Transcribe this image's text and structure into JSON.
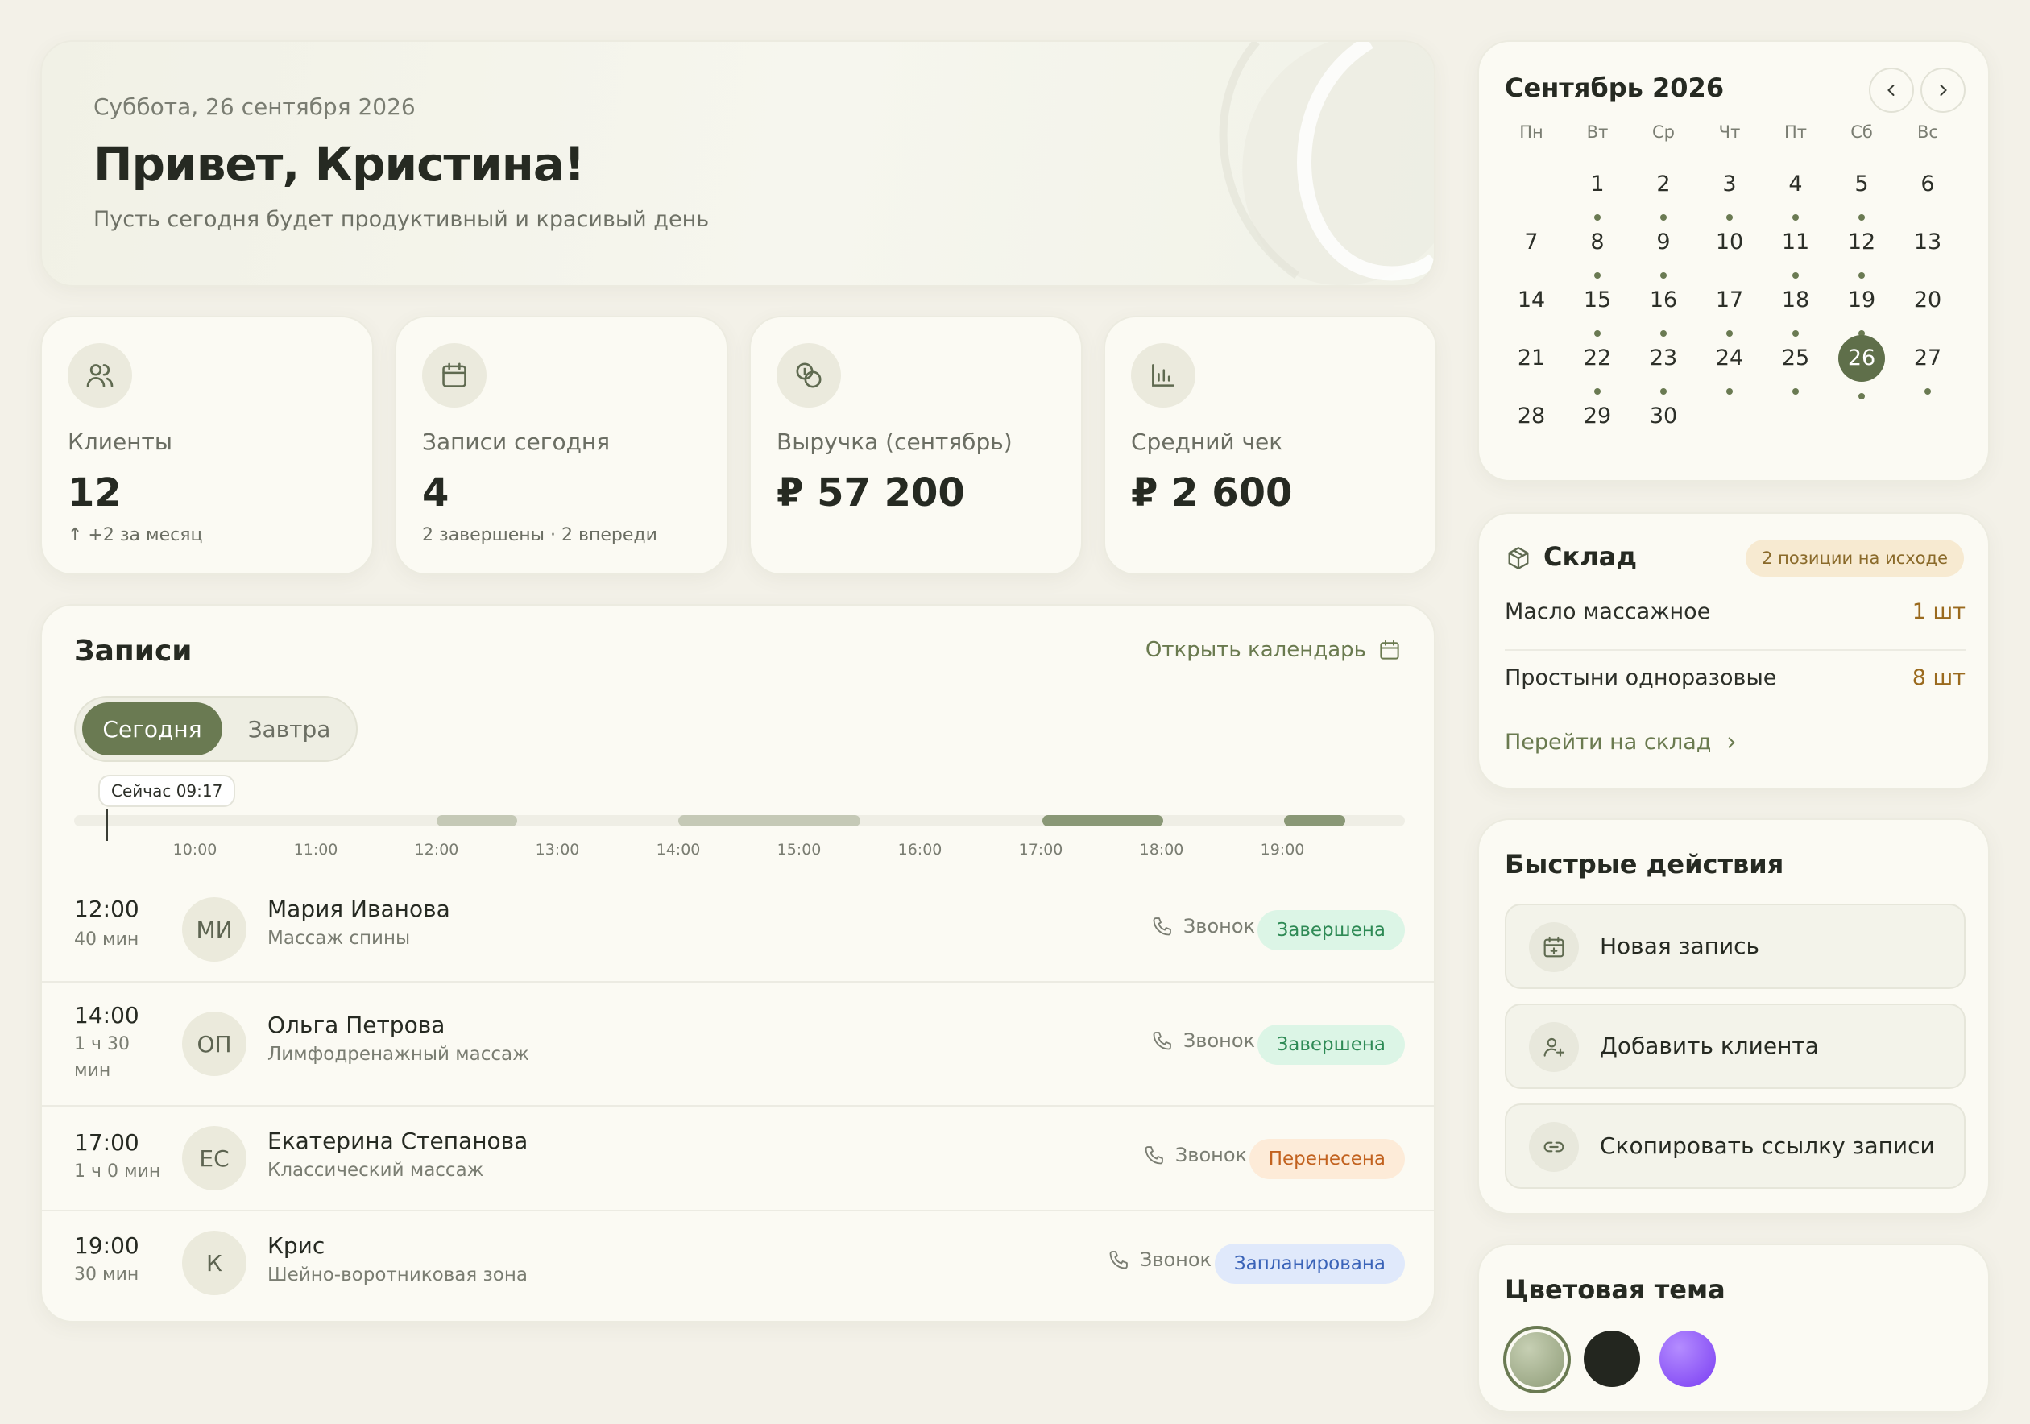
{
  "hero": {
    "date": "Суббота, 26 сентября 2026",
    "greeting": "Привет, Кристина!",
    "subtitle": "Пусть сегодня будет продуктивный и красивый день"
  },
  "stats": [
    {
      "label": "Клиенты",
      "value": "12",
      "note": "↑ +2 за месяц",
      "icon": "users-icon"
    },
    {
      "label": "Записи сегодня",
      "value": "4",
      "note": "2 завершены · 2 впереди",
      "icon": "calendar-icon"
    },
    {
      "label": "Выручка (сентябрь)",
      "value": "₽ 57 200",
      "note": "",
      "icon": "coins-icon"
    },
    {
      "label": "Средний чек",
      "value": "₽ 2 600",
      "note": "",
      "icon": "bar-chart-icon"
    }
  ],
  "appointments": {
    "title": "Записи",
    "open_calendar": "Открыть календарь",
    "tabs": {
      "today": "Сегодня",
      "tomorrow": "Завтра"
    },
    "now_label": "Сейчас 09:17",
    "ticks": [
      "10:00",
      "11:00",
      "12:00",
      "13:00",
      "14:00",
      "15:00",
      "16:00",
      "17:00",
      "18:00",
      "19:00"
    ],
    "rows": [
      {
        "time": "12:00",
        "duration": "40 мин",
        "initials": "МИ",
        "name": "Мария Иванова",
        "service": "Массаж спины",
        "call": "Звонок",
        "status": "Завершена"
      },
      {
        "time": "14:00",
        "duration": "1 ч 30 мин",
        "initials": "ОП",
        "name": "Ольга Петрова",
        "service": "Лимфодренажный массаж",
        "call": "Звонок",
        "status": "Завершена"
      },
      {
        "time": "17:00",
        "duration": "1 ч 0 мин",
        "initials": "ЕС",
        "name": "Екатерина Степанова",
        "service": "Классический массаж",
        "call": "Звонок",
        "status": "Перенесена"
      },
      {
        "time": "19:00",
        "duration": "30 мин",
        "initials": "К",
        "name": "Крис",
        "service": "Шейно-воротниковая зона",
        "call": "Звонок",
        "status": "Запланирована"
      }
    ]
  },
  "calendar": {
    "title": "Сентябрь 2026",
    "weekdays": [
      "Пн",
      "Вт",
      "Ср",
      "Чт",
      "Пт",
      "Сб",
      "Вс"
    ],
    "first_weekday_index": 1,
    "days_in_month": 30,
    "selected": 26,
    "days_with_dots": [
      1,
      2,
      3,
      4,
      5,
      8,
      9,
      11,
      12,
      15,
      16,
      17,
      18,
      19,
      22,
      23,
      24,
      25,
      26,
      27
    ]
  },
  "warehouse": {
    "title": "Склад",
    "badge": "2 позиции на исходе",
    "items": [
      {
        "name": "Масло массажное",
        "qty": "1 шт"
      },
      {
        "name": "Простыни одноразовые",
        "qty": "8 шт"
      }
    ],
    "link": "Перейти на склад"
  },
  "quick_actions": {
    "title": "Быстрые действия",
    "items": [
      {
        "label": "Новая запись",
        "icon": "calendar-plus-icon"
      },
      {
        "label": "Добавить клиента",
        "icon": "user-plus-icon"
      },
      {
        "label": "Скопировать ссылку записи",
        "icon": "link-icon"
      }
    ]
  },
  "theme": {
    "title": "Цветовая тема",
    "options": [
      "sage",
      "dark",
      "violet"
    ],
    "selected": "sage"
  },
  "colors": {
    "accent": "#6a7a52",
    "done": "#2e8a55",
    "moved": "#c2621f",
    "planned": "#3a63b8"
  }
}
